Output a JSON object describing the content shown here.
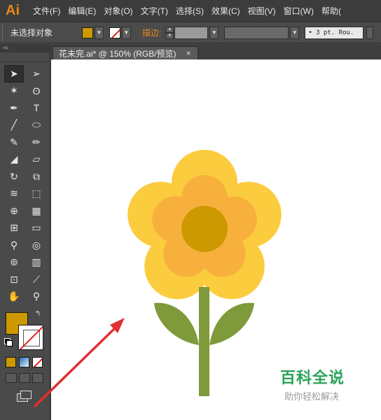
{
  "app": {
    "logo_text": "Ai"
  },
  "menu": {
    "items": [
      "文件(F)",
      "编辑(E)",
      "对象(O)",
      "文字(T)",
      "选择(S)",
      "效果(C)",
      "视图(V)",
      "窗口(W)",
      "帮助("
    ]
  },
  "controlbar": {
    "selection_label": "未选择对象",
    "fill_color": "#cc9900",
    "stroke_label": "描边:",
    "stroke_style": "• 3 pt. Rou."
  },
  "toolbox": {
    "collapse_label": "<<",
    "tools": [
      "selection-tool",
      "direct-selection-tool",
      "magic-wand-tool",
      "lasso-tool",
      "pen-tool",
      "type-tool",
      "line-segment-tool",
      "ellipse-tool",
      "paintbrush-tool",
      "pencil-tool",
      "blob-brush-tool",
      "eraser-tool",
      "rotate-tool",
      "scale-tool",
      "width-tool",
      "free-transform-tool",
      "shape-builder-tool",
      "perspective-grid-tool",
      "mesh-tool",
      "gradient-tool",
      "eyedropper-tool",
      "blend-tool",
      "symbol-sprayer-tool",
      "column-graph-tool",
      "artboard-tool",
      "slice-tool",
      "hand-tool",
      "zoom-tool"
    ],
    "fill_color": "#cc9900",
    "stroke_color": "none"
  },
  "document": {
    "tab_title": "花未完.ai* @ 150% (RGB/预览)",
    "close_glyph": "×"
  },
  "flower_colors": {
    "outer_petals": "#fccc3f",
    "inner_petals": "#f8b03d",
    "center": "#cc9900",
    "stem": "#7e9a3a",
    "arrow": "#e03030"
  },
  "watermark": {
    "title": "百科全说",
    "subtitle": "助你轻松解决"
  }
}
